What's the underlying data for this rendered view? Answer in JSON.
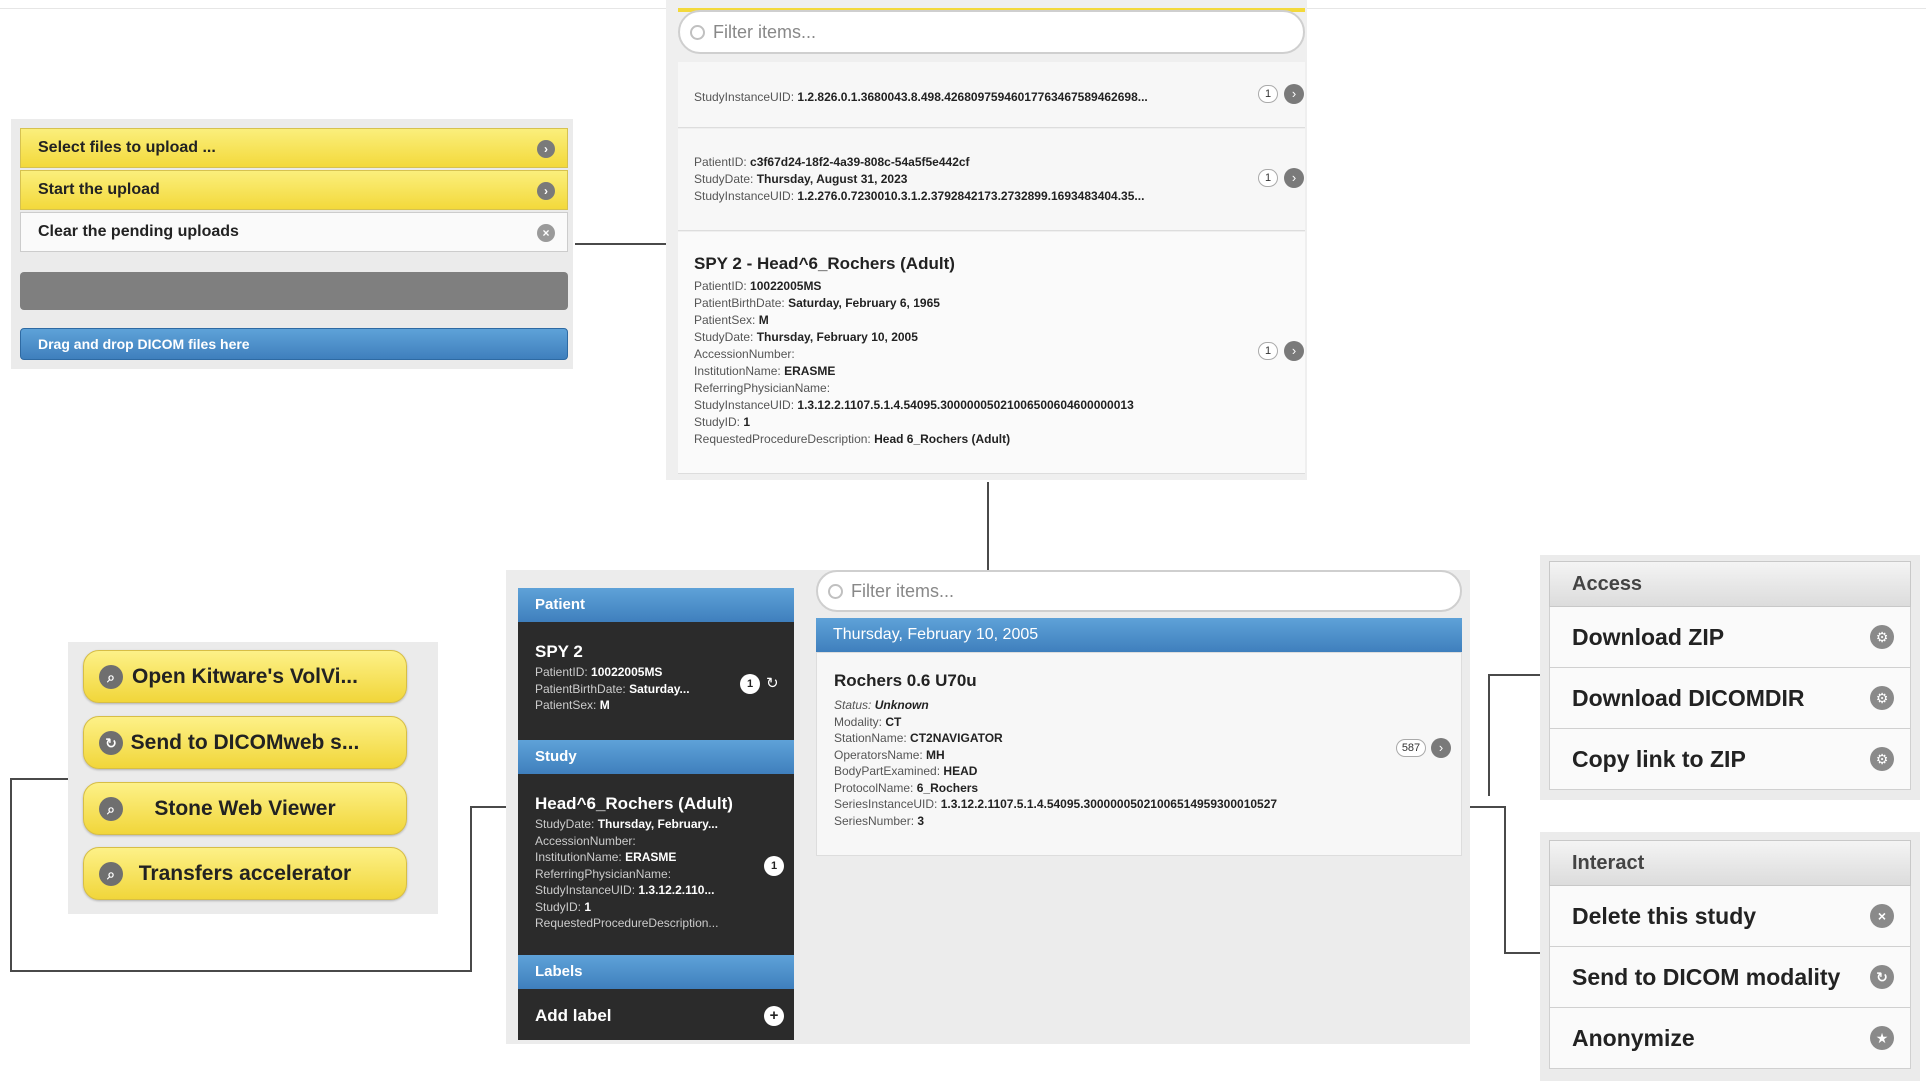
{
  "upload": {
    "select_label": "Select files to upload ...",
    "start_label": "Start the upload",
    "clear_label": "Clear the pending uploads",
    "drop_label": "Drag and drop DICOM files here"
  },
  "study_list": {
    "filter_placeholder": "Filter items...",
    "items": [
      {
        "uid_label": "StudyInstanceUID:",
        "uid": "1.2.826.0.1.3680043.8.498.42680975946017763467589462698...",
        "count": "1"
      },
      {
        "patient_id_label": "PatientID:",
        "patient_id": "c3f67d24-18f2-4a39-808c-54a5f5e442cf",
        "date_label": "StudyDate:",
        "date": "Thursday, August 31, 2023",
        "uid_label": "StudyInstanceUID:",
        "uid": "1.2.276.0.7230010.3.1.2.3792842173.2732899.1693483404.35...",
        "count": "1"
      },
      {
        "title": "SPY 2 - Head^6_Rochers (Adult)",
        "fields": [
          {
            "label": "PatientID:",
            "value": "10022005MS"
          },
          {
            "label": "PatientBirthDate:",
            "value": "Saturday, February 6, 1965"
          },
          {
            "label": "PatientSex:",
            "value": "M"
          },
          {
            "label": "StudyDate:",
            "value": "Thursday, February 10, 2005"
          },
          {
            "label": "AccessionNumber:",
            "value": ""
          },
          {
            "label": "InstitutionName:",
            "value": "ERASME"
          },
          {
            "label": "ReferringPhysicianName:",
            "value": ""
          },
          {
            "label": "StudyInstanceUID:",
            "value": "1.3.12.2.1107.5.1.4.54095.30000005021006500604600000013"
          },
          {
            "label": "StudyID:",
            "value": "1"
          },
          {
            "label": "RequestedProcedureDescription:",
            "value": "Head 6_Rochers (Adult)"
          }
        ],
        "count": "1"
      }
    ]
  },
  "side": {
    "patient_header": "Patient",
    "patient": {
      "name": "SPY 2",
      "fields": [
        {
          "label": "PatientID:",
          "value": "10022005MS"
        },
        {
          "label": "PatientBirthDate:",
          "value": "Saturday..."
        },
        {
          "label": "PatientSex:",
          "value": "M"
        }
      ],
      "count": "1"
    },
    "study_header": "Study",
    "study": {
      "name": "Head^6_Rochers (Adult)",
      "fields": [
        {
          "label": "StudyDate:",
          "value": "Thursday, February..."
        },
        {
          "label": "AccessionNumber:",
          "value": ""
        },
        {
          "label": "InstitutionName:",
          "value": "ERASME"
        },
        {
          "label": "ReferringPhysicianName:",
          "value": ""
        },
        {
          "label": "StudyInstanceUID:",
          "value": "1.3.12.2.110..."
        },
        {
          "label": "StudyID:",
          "value": "1"
        },
        {
          "label": "RequestedProcedureDescription...",
          "value": ""
        }
      ],
      "count": "1"
    },
    "labels_header": "Labels",
    "add_label": "Add label"
  },
  "series": {
    "filter_placeholder": "Filter items...",
    "date_header": "Thursday, February 10, 2005",
    "item": {
      "title": "Rochers 0.6 U70u",
      "status_label": "Status:",
      "status": "Unknown",
      "fields": [
        {
          "label": "Modality:",
          "value": "CT"
        },
        {
          "label": "StationName:",
          "value": "CT2NAVIGATOR"
        },
        {
          "label": "OperatorsName:",
          "value": "MH"
        },
        {
          "label": "BodyPartExamined:",
          "value": "HEAD"
        },
        {
          "label": "ProtocolName:",
          "value": "6_Rochers"
        },
        {
          "label": "SeriesInstanceUID:",
          "value": "1.3.12.2.1107.5.1.4.54095.30000005021006514959300010527"
        },
        {
          "label": "SeriesNumber:",
          "value": "3"
        }
      ],
      "count": "587"
    }
  },
  "plugins": [
    {
      "label": "Open Kitware's VolVi...",
      "icon": "search-icon"
    },
    {
      "label": "Send to DICOMweb s...",
      "icon": "send-icon"
    },
    {
      "label": "Stone Web Viewer",
      "icon": "search-icon"
    },
    {
      "label": "Transfers accelerator",
      "icon": "search-icon"
    }
  ],
  "access": {
    "header": "Access",
    "items": [
      {
        "label": "Download ZIP",
        "icon": "gear-icon"
      },
      {
        "label": "Download DICOMDIR",
        "icon": "gear-icon"
      },
      {
        "label": "Copy link to ZIP",
        "icon": "gear-icon"
      }
    ]
  },
  "interact": {
    "header": "Interact",
    "items": [
      {
        "label": "Delete this study",
        "icon": "delete-icon"
      },
      {
        "label": "Send to DICOM modality",
        "icon": "send-icon"
      },
      {
        "label": "Anonymize",
        "icon": "star-icon"
      }
    ]
  },
  "colors": {
    "accent_blue": "#3f7fbd",
    "button_yellow": "#f3d93b",
    "dark_panel": "#2b2b2b"
  }
}
